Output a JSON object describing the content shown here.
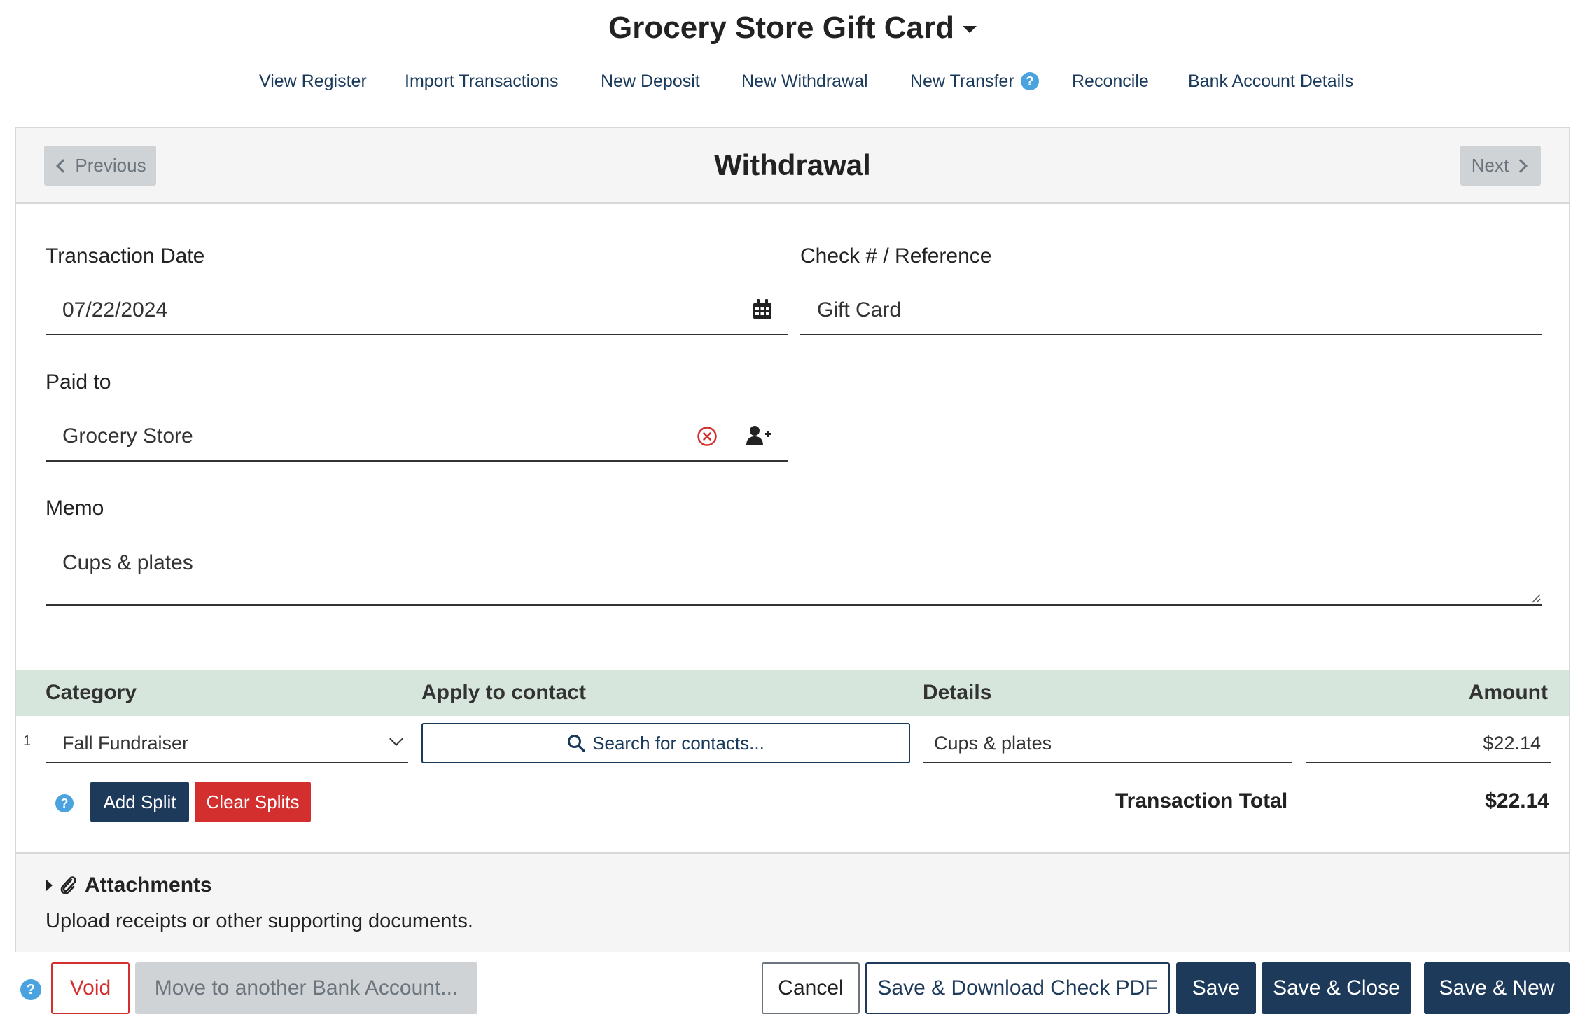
{
  "header": {
    "title": "Grocery Store Gift Card"
  },
  "nav": {
    "view_register": "View Register",
    "import_transactions": "Import Transactions",
    "new_deposit": "New Deposit",
    "new_withdrawal": "New Withdrawal",
    "new_transfer": "New Transfer",
    "reconcile": "Reconcile",
    "bank_account_details": "Bank Account Details",
    "help_glyph": "?"
  },
  "card": {
    "previous_label": "Previous",
    "next_label": "Next",
    "title": "Withdrawal"
  },
  "form": {
    "transaction_date_label": "Transaction Date",
    "transaction_date_value": "07/22/2024",
    "check_ref_label": "Check # / Reference",
    "check_ref_value": "Gift Card",
    "paid_to_label": "Paid to",
    "paid_to_value": "Grocery Store",
    "memo_label": "Memo",
    "memo_value": "Cups & plates"
  },
  "splits": {
    "headers": {
      "category": "Category",
      "apply_to_contact": "Apply to contact",
      "details": "Details",
      "amount": "Amount"
    },
    "rows": [
      {
        "num": "1",
        "category": "Fall Fundraiser",
        "contact_placeholder": "Search for contacts...",
        "details": "Cups & plates",
        "amount": "$22.14"
      }
    ],
    "add_split_label": "Add Split",
    "clear_splits_label": "Clear Splits",
    "help_glyph": "?",
    "total_label": "Transaction Total",
    "total_value": "$22.14"
  },
  "attachments": {
    "title": "Attachments",
    "description": "Upload receipts or other supporting documents."
  },
  "footer": {
    "help_glyph": "?",
    "void_label": "Void",
    "move_label": "Move to another Bank Account...",
    "cancel_label": "Cancel",
    "save_download_label": "Save & Download Check PDF",
    "save_label": "Save",
    "save_close_label": "Save & Close",
    "save_new_label": "Save & New"
  },
  "colors": {
    "navy": "#1e3a5a",
    "link": "#1a3a5c",
    "danger": "#d32f2f",
    "help": "#4aa3df",
    "splits_header_bg": "#d6e6dc"
  }
}
